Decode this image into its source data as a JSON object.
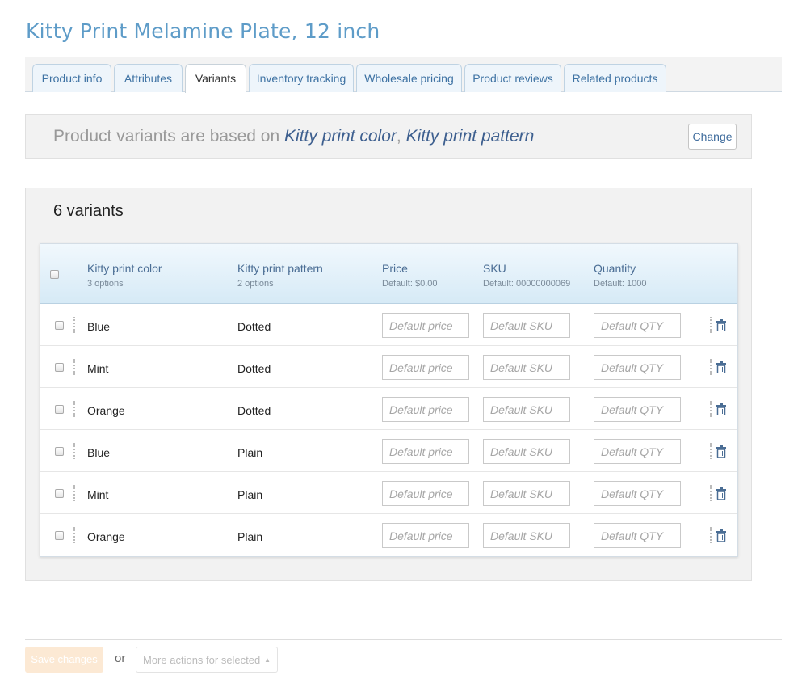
{
  "page": {
    "title": "Kitty Print Melamine Plate, 12 inch"
  },
  "tabs": [
    {
      "label": "Product info",
      "active": false
    },
    {
      "label": "Attributes",
      "active": false
    },
    {
      "label": "Variants",
      "active": true
    },
    {
      "label": "Inventory tracking",
      "active": false
    },
    {
      "label": "Wholesale pricing",
      "active": false
    },
    {
      "label": "Product reviews",
      "active": false
    },
    {
      "label": "Related products",
      "active": false
    }
  ],
  "base": {
    "prefix": "Product variants are based on ",
    "attr1": "Kitty print color",
    "sep": ", ",
    "attr2": "Kitty print pattern",
    "change_label": "Change"
  },
  "variants": {
    "count_label": "6 variants",
    "headers": {
      "color": {
        "label": "Kitty print color",
        "sub": "3 options"
      },
      "pattern": {
        "label": "Kitty print pattern",
        "sub": "2 options"
      },
      "price": {
        "label": "Price",
        "sub": "Default: $0.00"
      },
      "sku": {
        "label": "SKU",
        "sub": "Default: 00000000069"
      },
      "qty": {
        "label": "Quantity",
        "sub": "Default: 1000"
      }
    },
    "placeholders": {
      "price": "Default price",
      "sku": "Default SKU",
      "qty": "Default QTY"
    },
    "rows": [
      {
        "color": "Blue",
        "pattern": "Dotted"
      },
      {
        "color": "Mint",
        "pattern": "Dotted"
      },
      {
        "color": "Orange",
        "pattern": "Dotted"
      },
      {
        "color": "Blue",
        "pattern": "Plain"
      },
      {
        "color": "Mint",
        "pattern": "Plain"
      },
      {
        "color": "Orange",
        "pattern": "Plain"
      }
    ]
  },
  "footer": {
    "save_label": "Save changes",
    "or_label": "or",
    "more_label": "More actions for selected"
  },
  "colors": {
    "title": "#5e9cc8",
    "tab_text": "#3e72a3",
    "attr_text": "#3d5f8f",
    "save_bg": "#fce9d4"
  },
  "icons": {
    "delete": "trash-icon",
    "more_caret": "caret-up-icon"
  }
}
